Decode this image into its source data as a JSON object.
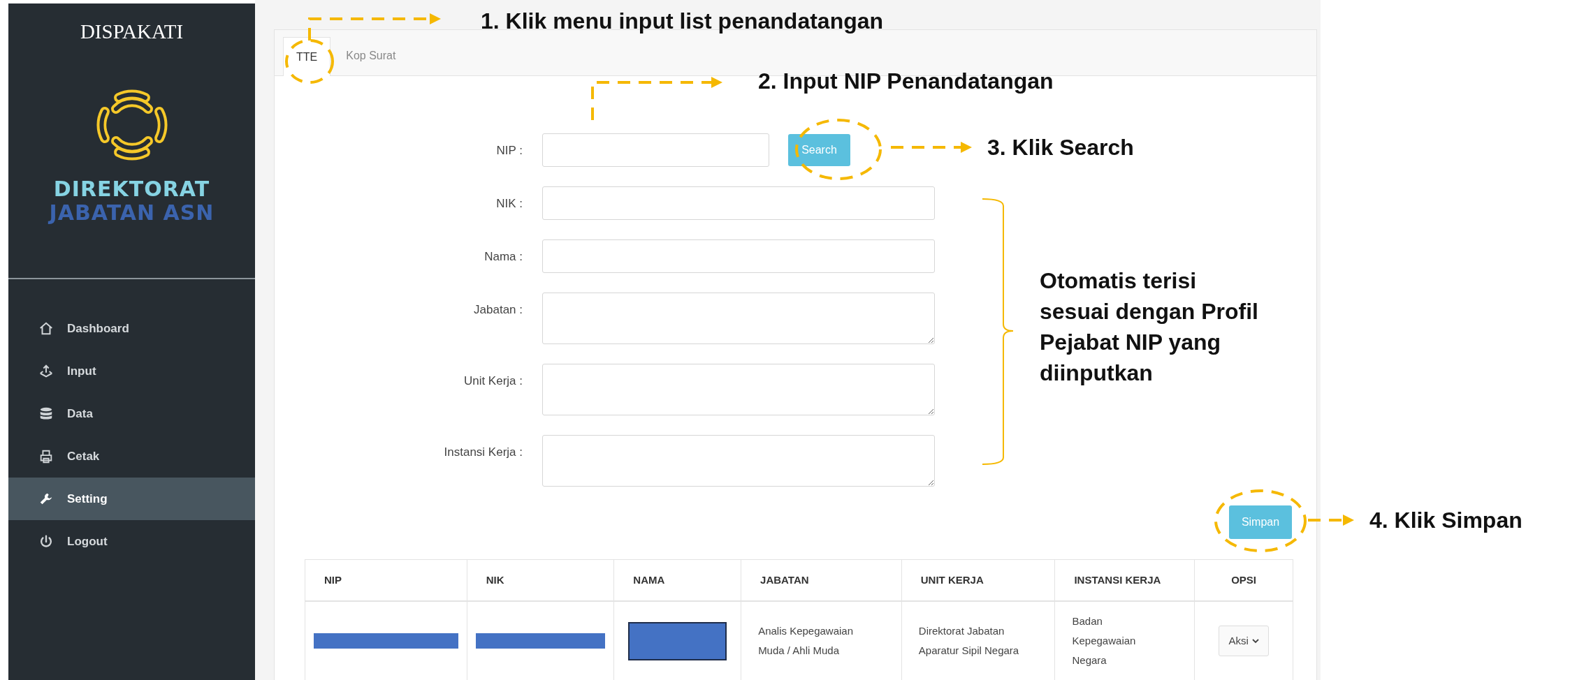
{
  "sidebar": {
    "title": "DISPAKATI",
    "logo_lines": [
      "DIREKTORAT",
      "JABATAN ASN"
    ],
    "menu": [
      {
        "label": "Dashboard",
        "selected": false
      },
      {
        "label": "Input",
        "selected": false
      },
      {
        "label": "Data",
        "selected": false
      },
      {
        "label": "Cetak",
        "selected": false
      },
      {
        "label": "Setting",
        "selected": true
      },
      {
        "label": "Logout",
        "selected": false
      }
    ]
  },
  "tabs": [
    {
      "label": "TTE",
      "selected": true
    },
    {
      "label": "Kop Surat",
      "selected": false
    }
  ],
  "form": {
    "fields": [
      {
        "label": "NIP :",
        "kind": "input",
        "button": "Search"
      },
      {
        "label": "NIK :",
        "kind": "input"
      },
      {
        "label": "Nama :",
        "kind": "input"
      },
      {
        "label": "Jabatan :",
        "kind": "textarea"
      },
      {
        "label": "Unit Kerja :",
        "kind": "textarea"
      },
      {
        "label": "Instansi Kerja :",
        "kind": "textarea"
      }
    ],
    "submit": "Simpan"
  },
  "table": {
    "columns": [
      "NIP",
      "NIK",
      "NAMA",
      "JABATAN",
      "UNIT KERJA",
      "INSTANSI KERJA",
      "OPSI"
    ],
    "rows": [
      [
        {
          "kind": "redacted_bar"
        },
        {
          "kind": "redacted_bar"
        },
        {
          "kind": "redacted_block"
        },
        {
          "kind": "text",
          "text": "Analis Kepegawaian Muda / Ahli Muda"
        },
        {
          "kind": "text",
          "text": "Direktorat Jabatan Aparatur Sipil Negara"
        },
        {
          "kind": "text",
          "text": "Badan Kepegawaian Negara"
        },
        {
          "kind": "dropdown",
          "text": "Aksi"
        }
      ]
    ]
  },
  "annotations": {
    "step1": "1. Klik menu input list penandatangan",
    "step2": "2. Input NIP Penandatangan",
    "step3": "3. Klik Search",
    "note": "Otomatis terisi sesuai dengan Profil Pejabat NIP yang diinputkan",
    "step4": "4. Klik Simpan"
  }
}
